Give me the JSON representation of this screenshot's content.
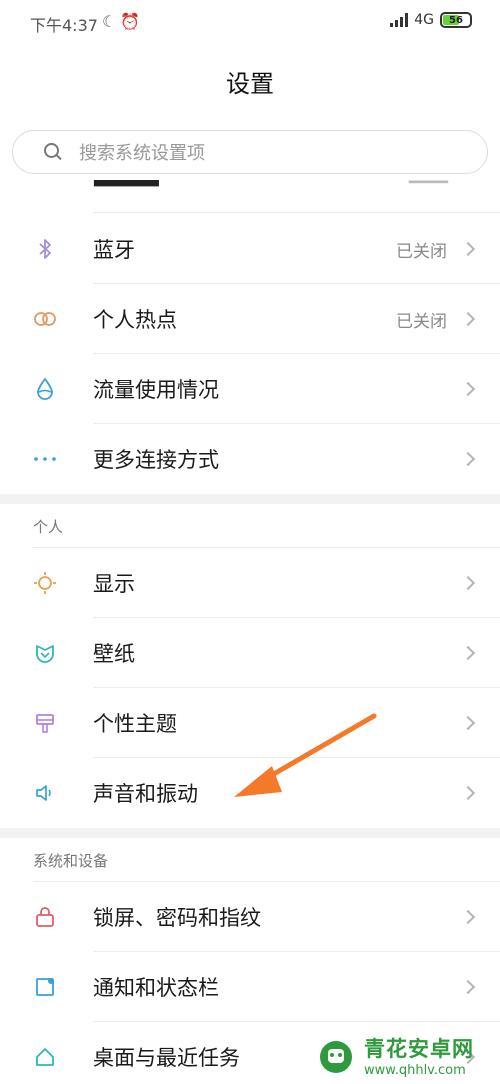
{
  "status_bar": {
    "time": "下午4:37",
    "network": "4G",
    "battery": "56",
    "battery_fraction": 0.56
  },
  "header": {
    "title": "设置"
  },
  "search": {
    "placeholder": "搜索系统设置项"
  },
  "connectivity": {
    "items": [
      {
        "label": "蓝牙",
        "value": "已关闭",
        "icon": "bluetooth-icon",
        "color": "#a58be0"
      },
      {
        "label": "个人热点",
        "value": "已关闭",
        "icon": "hotspot-icon",
        "color": "#e39a63"
      },
      {
        "label": "流量使用情况",
        "value": "",
        "icon": "data-usage-icon",
        "color": "#3a9fd6"
      },
      {
        "label": "更多连接方式",
        "value": "",
        "icon": "more-icon",
        "color": "#3a9fd6"
      }
    ]
  },
  "personal": {
    "header": "个人",
    "items": [
      {
        "label": "显示",
        "icon": "brightness-icon",
        "color": "#e8a24a"
      },
      {
        "label": "壁纸",
        "icon": "wallpaper-icon",
        "color": "#2dbab0"
      },
      {
        "label": "个性主题",
        "icon": "theme-icon",
        "color": "#b083e0"
      },
      {
        "label": "声音和振动",
        "icon": "speaker-icon",
        "color": "#3a9fd6"
      }
    ]
  },
  "system": {
    "header": "系统和设备",
    "items": [
      {
        "label": "锁屏、密码和指纹",
        "icon": "lock-icon",
        "color": "#e25c6a"
      },
      {
        "label": "通知和状态栏",
        "icon": "notification-icon",
        "color": "#3a9fd6"
      },
      {
        "label": "桌面与最近任务",
        "icon": "home-icon",
        "color": "#2dbab0"
      }
    ]
  },
  "watermark": {
    "name": "青花安卓网",
    "url": "www.qhhlv.com"
  },
  "colors": {
    "annotation_arrow": "#f5792a",
    "watermark_green": "#2e9a3c"
  }
}
